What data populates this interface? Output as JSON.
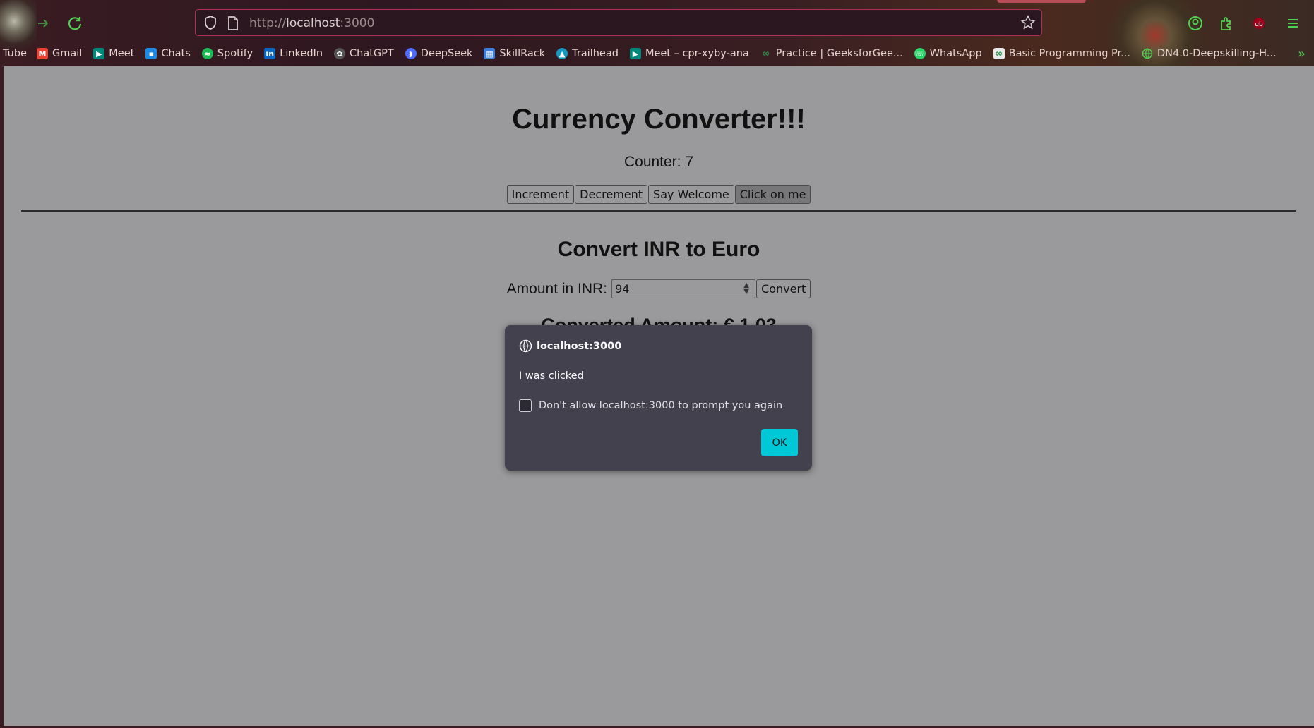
{
  "browser": {
    "url_scheme": "http://",
    "url_host": "localhost",
    "url_port": ":3000",
    "bookmarks": [
      {
        "label": "Tube",
        "icon": "youtube-icon",
        "color": "#ff0000"
      },
      {
        "label": "Gmail",
        "icon": "gmail-icon",
        "color": "#ea4335"
      },
      {
        "label": "Meet",
        "icon": "meet-icon",
        "color": "#00897b"
      },
      {
        "label": "Chats",
        "icon": "chat-icon",
        "color": "#1e88e5"
      },
      {
        "label": "Spotify",
        "icon": "spotify-icon",
        "color": "#1db954"
      },
      {
        "label": "LinkedIn",
        "icon": "linkedin-icon",
        "color": "#0a66c2"
      },
      {
        "label": "ChatGPT",
        "icon": "chatgpt-icon",
        "color": "#555555"
      },
      {
        "label": "DeepSeek",
        "icon": "deepseek-icon",
        "color": "#4d6bfe"
      },
      {
        "label": "SkillRack",
        "icon": "skillrack-icon",
        "color": "#3b7dd8"
      },
      {
        "label": "Trailhead",
        "icon": "trailhead-icon",
        "color": "#1798c1"
      },
      {
        "label": "Meet – cpr-xyby-ana",
        "icon": "meet-icon",
        "color": "#00897b"
      },
      {
        "label": "Practice | GeeksforGee...",
        "icon": "gfg-icon",
        "color": "#2f8d46"
      },
      {
        "label": "WhatsApp",
        "icon": "whatsapp-icon",
        "color": "#25d366"
      },
      {
        "label": "Basic Programming Pr...",
        "icon": "gfg-icon",
        "color": "#2f8d46"
      },
      {
        "label": "DN4.0-Deepskilling-H...",
        "icon": "globe-icon",
        "color": "#4fd24f"
      }
    ],
    "accent_color": "#4fd24f"
  },
  "page": {
    "title": "Currency Converter!!!",
    "counter_text": "Counter: 7",
    "buttons": {
      "increment": "Increment",
      "decrement": "Decrement",
      "say_welcome": "Say Welcome",
      "click_on_me": "Click on me"
    },
    "converter": {
      "heading": "Convert INR to Euro",
      "amount_label": "Amount in INR:",
      "amount_value": "94",
      "convert_button": "Convert",
      "result_text": "Converted Amount: € 1.03"
    }
  },
  "dialog": {
    "host": "localhost:3000",
    "message": "I was clicked",
    "checkbox_label": "Don't allow localhost:3000 to prompt you again",
    "checkbox_checked": false,
    "ok_label": "OK",
    "ok_color": "#00c8d7",
    "bg_color": "#42414d"
  }
}
